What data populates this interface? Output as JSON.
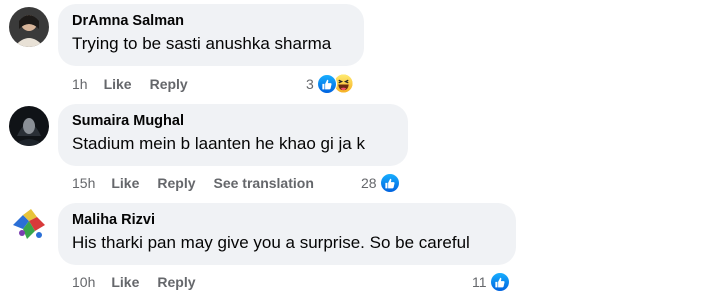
{
  "comments": [
    {
      "author": "DrAmna Salman",
      "text": "Trying to be sasti anushka sharma",
      "time": "1h",
      "like_label": "Like",
      "reply_label": "Reply",
      "reaction_count": "3",
      "reactions": [
        "like-icon",
        "haha-icon"
      ]
    },
    {
      "author": "Sumaira Mughal",
      "text": "Stadium mein b laanten he khao gi ja k",
      "time": "15h",
      "like_label": "Like",
      "reply_label": "Reply",
      "see_translation_label": "See translation",
      "reaction_count": "28",
      "reactions": [
        "like-icon"
      ]
    },
    {
      "author": "Maliha Rizvi",
      "text": "His tharki pan may give you a surprise. So be careful",
      "time": "10h",
      "like_label": "Like",
      "reply_label": "Reply",
      "reaction_count": "11",
      "reactions": [
        "like-icon"
      ]
    }
  ],
  "colors": {
    "bubble_bg": "#f0f2f5",
    "meta_text": "#65676b",
    "like_blue": "#1877f2"
  }
}
